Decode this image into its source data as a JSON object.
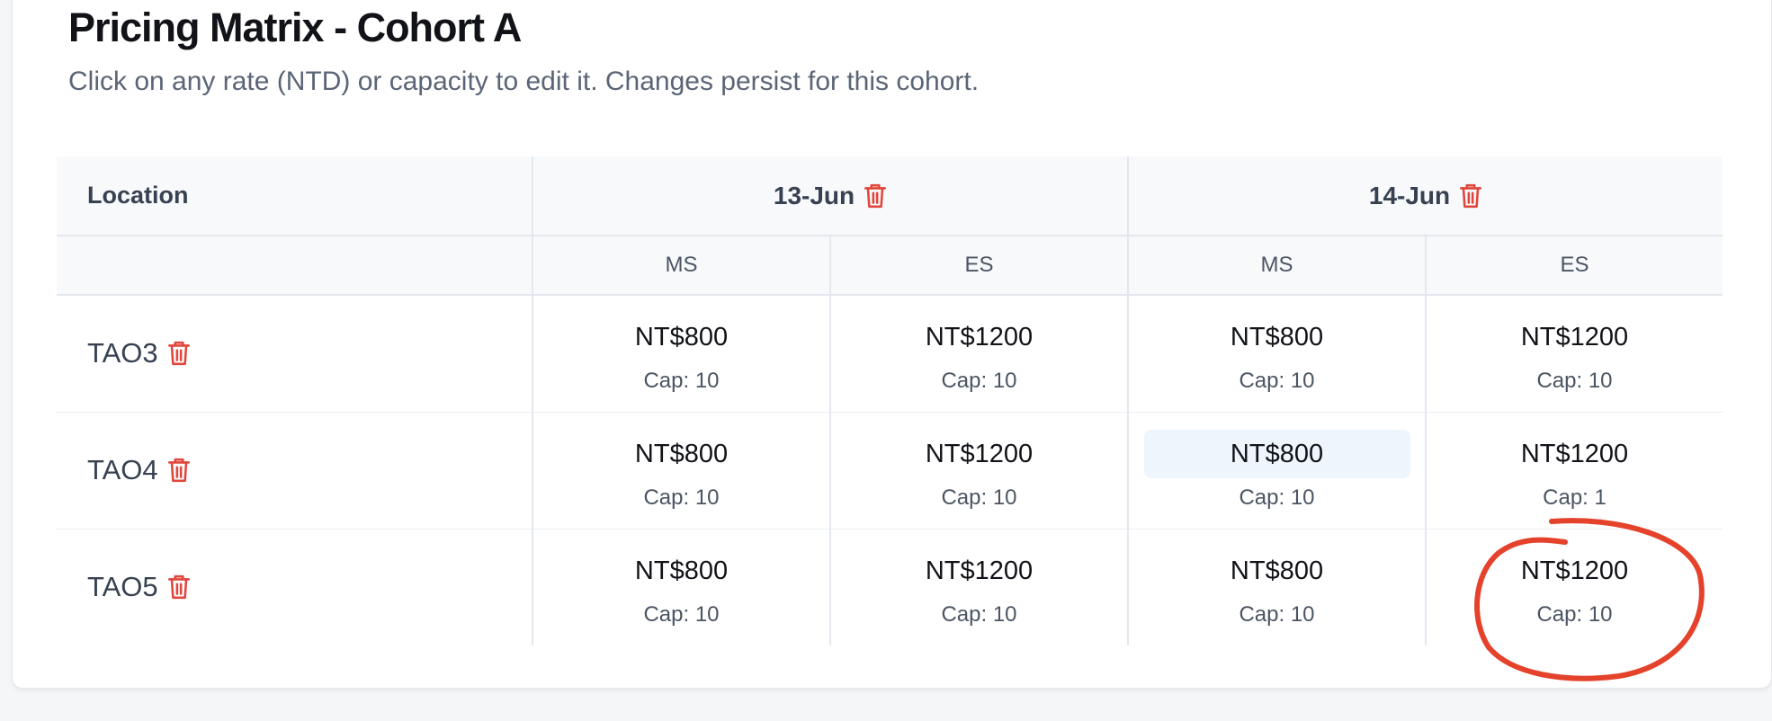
{
  "header": {
    "title": "Pricing Matrix - Cohort A",
    "subtitle": "Click on any rate (NTD) or capacity to edit it. Changes persist for this cohort."
  },
  "table": {
    "location_header": "Location",
    "dates": [
      {
        "label": "13-Jun",
        "icon": "trash-icon",
        "sessions": [
          "MS",
          "ES"
        ]
      },
      {
        "label": "14-Jun",
        "icon": "trash-icon",
        "sessions": [
          "MS",
          "ES"
        ]
      }
    ],
    "rows": [
      {
        "location": "TAO3",
        "cells": [
          {
            "rate": "NT$800",
            "cap": "Cap: 10"
          },
          {
            "rate": "NT$1200",
            "cap": "Cap: 10"
          },
          {
            "rate": "NT$800",
            "cap": "Cap: 10"
          },
          {
            "rate": "NT$1200",
            "cap": "Cap: 10"
          }
        ]
      },
      {
        "location": "TAO4",
        "cells": [
          {
            "rate": "NT$800",
            "cap": "Cap: 10"
          },
          {
            "rate": "NT$1200",
            "cap": "Cap: 10"
          },
          {
            "rate": "NT$800",
            "cap": "Cap: 10",
            "highlighted": true
          },
          {
            "rate": "NT$1200",
            "cap": "Cap: 1"
          }
        ]
      },
      {
        "location": "TAO5",
        "cells": [
          {
            "rate": "NT$800",
            "cap": "Cap: 10"
          },
          {
            "rate": "NT$1200",
            "cap": "Cap: 10"
          },
          {
            "rate": "NT$800",
            "cap": "Cap: 10"
          },
          {
            "rate": "NT$1200",
            "cap": "Cap: 10",
            "annotated": true
          }
        ]
      }
    ]
  },
  "colors": {
    "danger": "#e0473c",
    "highlight_bg": "#eef5fd",
    "annotation": "#e5422c"
  }
}
